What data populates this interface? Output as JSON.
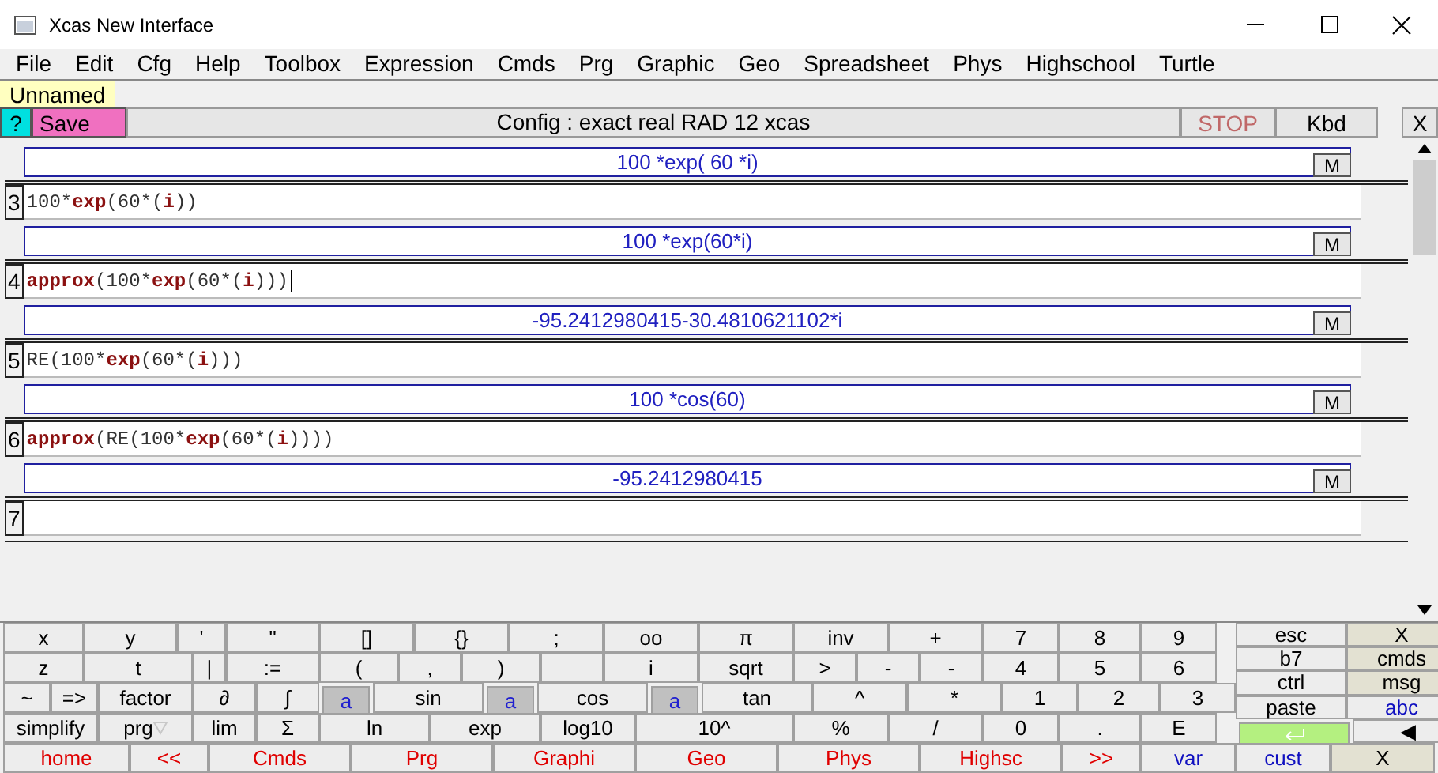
{
  "window": {
    "title": "Xcas New Interface"
  },
  "menu": [
    "File",
    "Edit",
    "Cfg",
    "Help",
    "Toolbox",
    "Expression",
    "Cmds",
    "Prg",
    "Graphic",
    "Geo",
    "Spreadsheet",
    "Phys",
    "Highschool",
    "Turtle"
  ],
  "tabs": [
    {
      "label": "Unnamed",
      "selected": true
    }
  ],
  "toolbar": {
    "help": "?",
    "save": "Save",
    "config": "Config  : exact real RAD 12 xcas",
    "stop": "STOP",
    "stop_disabled": true,
    "kbd": "Kbd",
    "close": "X"
  },
  "partial_output": {
    "text": "100 *exp( 60 *i)",
    "button": "M"
  },
  "entries": [
    {
      "number": "3",
      "input": [
        {
          "text": "100*",
          "keyword": false
        },
        {
          "text": "exp",
          "keyword": true
        },
        {
          "text": "(60*(",
          "keyword": false
        },
        {
          "text": "i",
          "keyword": true
        },
        {
          "text": "))",
          "keyword": false
        }
      ],
      "output": "100 *exp(60*i)",
      "button": "M"
    },
    {
      "number": "4",
      "input": [
        {
          "text": "approx",
          "keyword": true
        },
        {
          "text": "(100*",
          "keyword": false
        },
        {
          "text": "exp",
          "keyword": true
        },
        {
          "text": "(60*(",
          "keyword": false
        },
        {
          "text": "i",
          "keyword": true
        },
        {
          "text": ")))",
          "keyword": false
        }
      ],
      "output": "-95.2412980415-30.4810621102*i",
      "button": "M",
      "caret": true
    },
    {
      "number": "5",
      "input": [
        {
          "text": "RE(100*",
          "keyword": false
        },
        {
          "text": "exp",
          "keyword": true
        },
        {
          "text": "(60*(",
          "keyword": false
        },
        {
          "text": "i",
          "keyword": true
        },
        {
          "text": ")))",
          "keyword": false
        }
      ],
      "output": "100 *cos(60)",
      "button": "M"
    },
    {
      "number": "6",
      "input": [
        {
          "text": "approx",
          "keyword": true
        },
        {
          "text": "(RE(100*",
          "keyword": false
        },
        {
          "text": "exp",
          "keyword": true
        },
        {
          "text": "(60*(",
          "keyword": false
        },
        {
          "text": "i",
          "keyword": true
        },
        {
          "text": "))))",
          "keyword": false
        }
      ],
      "output": "-95.2412980415",
      "button": "M"
    },
    {
      "number": "7"
    }
  ],
  "keypad": {
    "main": [
      [
        {
          "label": "x",
          "kind": "key"
        },
        {
          "label": "y",
          "kind": "key"
        },
        {
          "label": "'",
          "kind": "key"
        },
        {
          "label": "\"",
          "kind": "key"
        },
        {
          "label": "[]",
          "kind": "key"
        },
        {
          "label": "{}",
          "kind": "key"
        },
        {
          "label": ";",
          "kind": "key"
        },
        {
          "label": "oo",
          "kind": "key"
        },
        {
          "label": "π",
          "kind": "key"
        },
        {
          "label": "inv",
          "kind": "key"
        },
        {
          "label": "+",
          "kind": "key"
        },
        {
          "label": "7",
          "kind": "key"
        },
        {
          "label": "8",
          "kind": "key"
        },
        {
          "label": "9",
          "kind": "key"
        }
      ],
      [
        {
          "label": "z",
          "kind": "key"
        },
        {
          "label": "t",
          "kind": "key"
        },
        {
          "label": "|",
          "kind": "key"
        },
        {
          "label": ":=",
          "kind": "key"
        },
        {
          "label": "(",
          "kind": "key"
        },
        {
          "label": ",",
          "kind": "key"
        },
        {
          "label": ")",
          "kind": "key"
        },
        {
          "kind": "key"
        },
        {
          "label": "i",
          "kind": "key"
        },
        {
          "label": "sqrt",
          "kind": "key"
        },
        {
          "label": ">",
          "kind": "key"
        },
        {
          "label": "-",
          "kind": "key"
        },
        {
          "label": "-",
          "kind": "key"
        },
        {
          "label": "4",
          "kind": "key"
        },
        {
          "label": "5",
          "kind": "key"
        },
        {
          "label": "6",
          "kind": "key"
        }
      ],
      [
        {
          "label": "~",
          "kind": "key"
        },
        {
          "label": "=>",
          "kind": "key"
        },
        {
          "label": "factor",
          "kind": "key"
        },
        {
          "label": "∂",
          "kind": "key"
        },
        {
          "label": "∫",
          "kind": "key"
        },
        {
          "label": "a",
          "kind": "letter"
        },
        {
          "label": "sin",
          "kind": "key"
        },
        {
          "label": "a",
          "kind": "letter"
        },
        {
          "label": "cos",
          "kind": "key"
        },
        {
          "label": "a",
          "kind": "letter"
        },
        {
          "label": "tan",
          "kind": "key"
        },
        {
          "label": "^",
          "kind": "key"
        },
        {
          "label": "*",
          "kind": "key"
        },
        {
          "label": "1",
          "kind": "key"
        },
        {
          "label": "2",
          "kind": "key"
        },
        {
          "label": "3",
          "kind": "key"
        }
      ],
      [
        {
          "label": "simplify",
          "kind": "key"
        },
        {
          "label": "prg",
          "kind": "menu"
        },
        {
          "label": "lim",
          "kind": "key"
        },
        {
          "label": "Σ",
          "kind": "key"
        },
        {
          "label": "ln",
          "kind": "key"
        },
        {
          "label": "exp",
          "kind": "key"
        },
        {
          "label": "log10",
          "kind": "key"
        },
        {
          "label": "10^",
          "kind": "key"
        },
        {
          "label": "%",
          "kind": "key"
        },
        {
          "label": "/",
          "kind": "key"
        },
        {
          "label": "0",
          "kind": "key"
        },
        {
          "label": ".",
          "kind": "key"
        },
        {
          "label": "E",
          "kind": "key"
        }
      ]
    ],
    "side": [
      [
        {
          "label": "esc",
          "kind": "key"
        },
        {
          "label": "X",
          "kind": "beige"
        }
      ],
      [
        {
          "label": "b7",
          "kind": "key"
        },
        {
          "label": "cmds",
          "kind": "beige"
        }
      ],
      [
        {
          "label": "ctrl",
          "kind": "key"
        },
        {
          "label": "msg",
          "kind": "beige"
        }
      ],
      [
        {
          "label": "paste",
          "kind": "key"
        },
        {
          "label": "abc",
          "kind": "blue"
        }
      ],
      [
        {
          "kind": "enter"
        },
        {
          "label": "◀",
          "kind": "key"
        }
      ]
    ],
    "bottom": [
      {
        "label": "home",
        "kind": "red"
      },
      {
        "label": "<<",
        "kind": "red"
      },
      {
        "label": "Cmds",
        "kind": "red"
      },
      {
        "label": "Prg",
        "kind": "red"
      },
      {
        "label": "Graphi",
        "kind": "red"
      },
      {
        "label": "Geo",
        "kind": "red"
      },
      {
        "label": "Phys",
        "kind": "red"
      },
      {
        "label": "Highsc",
        "kind": "red"
      },
      {
        "label": ">>",
        "kind": "red"
      },
      {
        "label": "var",
        "kind": "blue"
      },
      {
        "label": "cust",
        "kind": "blue"
      },
      {
        "label": "X",
        "kind": "beige"
      }
    ]
  }
}
